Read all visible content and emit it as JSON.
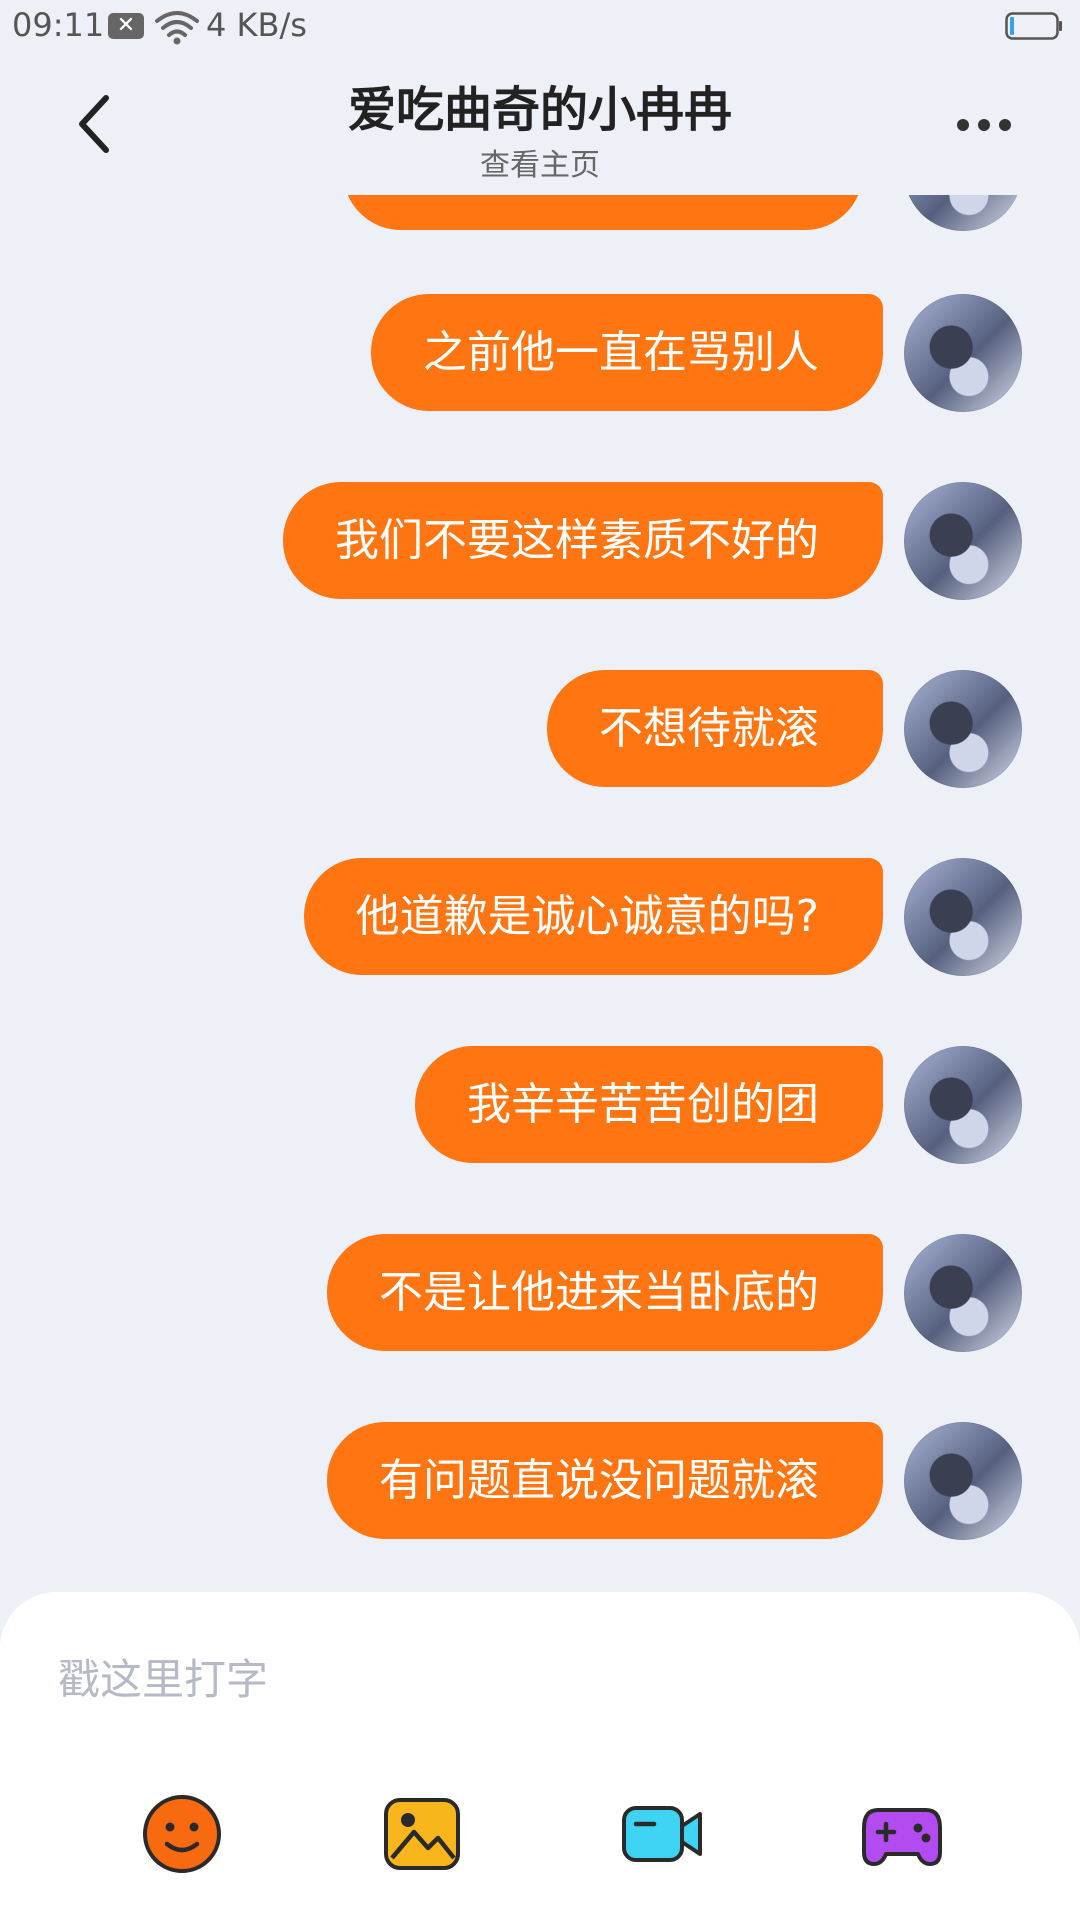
{
  "status_bar": {
    "time": "09:11",
    "notification_icon": "close-notification-icon",
    "network_speed": "4 KB/s",
    "battery": "battery-icon"
  },
  "header": {
    "title": "爱吃曲奇的小冉冉",
    "subtitle": "查看主页",
    "back_icon": "back-arrow-icon",
    "more_icon": "more-dots-icon"
  },
  "messages": [
    {
      "text": "之前他一直在骂别人",
      "sender": "self"
    },
    {
      "text": "我们不要这样素质不好的",
      "sender": "self"
    },
    {
      "text": "不想待就滚",
      "sender": "self"
    },
    {
      "text": "他道歉是诚心诚意的吗?",
      "sender": "self"
    },
    {
      "text": "我辛辛苦苦创的团",
      "sender": "self"
    },
    {
      "text": "不是让他进来当卧底的",
      "sender": "self"
    },
    {
      "text": "有问题直说没问题就滚",
      "sender": "self"
    }
  ],
  "input": {
    "placeholder": "戳这里打字",
    "value": ""
  },
  "toolbar": [
    {
      "icon": "emoji-icon",
      "color": "#f86a10"
    },
    {
      "icon": "image-icon",
      "color": "#f9b51c"
    },
    {
      "icon": "video-call-icon",
      "color": "#3fd3f3"
    },
    {
      "icon": "game-controller-icon",
      "color": "#b34cf0"
    }
  ],
  "colors": {
    "background": "#eef0f8",
    "bubble": "#fe7512",
    "bubble_text": "#ffffff"
  }
}
